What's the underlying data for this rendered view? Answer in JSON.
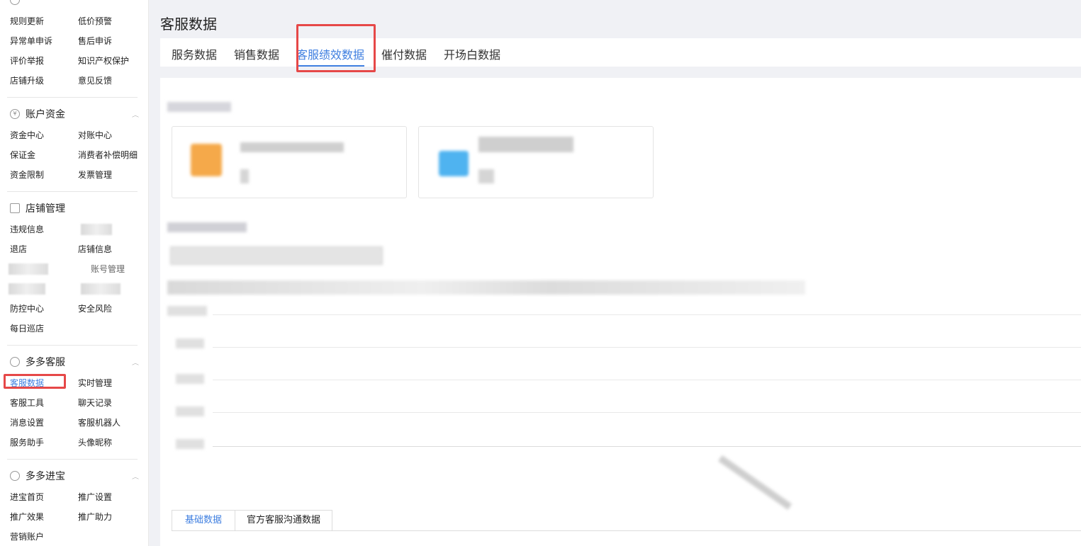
{
  "sidebar": {
    "top_group": {
      "rows": [
        [
          "规则更新",
          "低价预警"
        ],
        [
          "异常单申诉",
          "售后申诉"
        ],
        [
          "评价举报",
          "知识产权保护"
        ],
        [
          "店铺升级",
          "意见反馈"
        ]
      ]
    },
    "account": {
      "title": "账户资金",
      "icon": "yen-icon",
      "rows": [
        [
          "资金中心",
          "对账中心"
        ],
        [
          "保证金",
          "消费者补偿明细"
        ],
        [
          "资金限制",
          "发票管理"
        ]
      ]
    },
    "store": {
      "title": "店铺管理",
      "icon": "store-icon",
      "rows": [
        [
          "违规信息",
          ""
        ],
        [
          "退店",
          "店铺信息"
        ],
        [
          "",
          "账号管理"
        ],
        [
          "",
          ""
        ],
        [
          "防控中心",
          "安全风险"
        ],
        [
          "每日巡店",
          ""
        ]
      ]
    },
    "service": {
      "title": "多多客服",
      "icon": "headset-icon",
      "rows": [
        [
          "客服数据",
          "实时管理"
        ],
        [
          "客服工具",
          "聊天记录"
        ],
        [
          "消息设置",
          "客服机器人"
        ],
        [
          "服务助手",
          "头像昵称"
        ]
      ],
      "active": "客服数据"
    },
    "promo": {
      "title": "多多进宝",
      "icon": "treasure-icon",
      "rows": [
        [
          "进宝首页",
          "推广设置"
        ],
        [
          "推广效果",
          "推广助力"
        ],
        [
          "营销账户",
          ""
        ]
      ]
    }
  },
  "main": {
    "title": "客服数据",
    "tabs": [
      "服务数据",
      "销售数据",
      "客服绩效数据",
      "催付数据",
      "开场白数据"
    ],
    "active_tab": "客服绩效数据",
    "bottom_tabs": [
      "基础数据",
      "官方客服沟通数据"
    ],
    "active_bottom_tab": "基础数据"
  },
  "colors": {
    "accent": "#3f7fe0",
    "highlight": "#e64848",
    "card_orange": "#f5a94a",
    "card_blue": "#4fb3f0"
  }
}
